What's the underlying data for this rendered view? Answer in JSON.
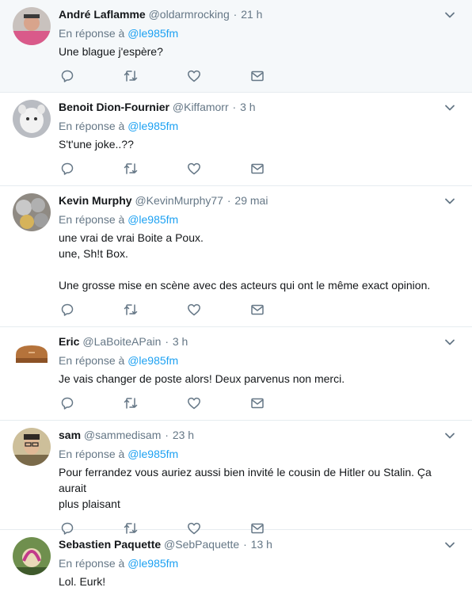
{
  "reply_prefix": "En réponse à",
  "tweets": [
    {
      "name": "André Laflamme",
      "handle": "@oldarmrocking",
      "time": "21 h",
      "reply_to": "@le985fm",
      "lines": [
        "Une blague j'espère?"
      ],
      "highlight": true
    },
    {
      "name": "Benoit Dion-Fournier",
      "handle": "@Kiffamorr",
      "time": "3 h",
      "reply_to": "@le985fm",
      "lines": [
        "S't'une joke..??"
      ]
    },
    {
      "name": "Kevin Murphy",
      "handle": "@KevinMurphy77",
      "time": "29 mai",
      "reply_to": "@le985fm",
      "lines": [
        "une vrai de vrai Boite a Poux.",
        "une, Sh!t Box.",
        "Une grosse mise en scène avec des acteurs qui ont le même exact opinion."
      ]
    },
    {
      "name": "Eric",
      "handle": "@LaBoiteAPain",
      "time": "3 h",
      "reply_to": "@le985fm",
      "lines": [
        "Je vais changer de poste alors! Deux parvenus non merci."
      ]
    },
    {
      "name": "sam",
      "handle": "@sammedisam",
      "time": "23 h",
      "reply_to": "@le985fm",
      "lines": [
        "Pour ferrandez vous auriez aussi bien invité le cousin de Hitler ou Stalin. Ça aurait",
        "plus plaisant"
      ]
    },
    {
      "name": "Sebastien Paquette",
      "handle": "@SebPaquette",
      "time": "13 h",
      "reply_to": "@le985fm",
      "lines": [
        "Lol. Eurk!"
      ]
    }
  ],
  "icons": {
    "reply": "reply-icon",
    "retweet": "retweet-icon",
    "like": "heart-icon",
    "dm": "envelope-icon",
    "more": "chevron-down-icon"
  },
  "colors": {
    "icon": "#657786",
    "link": "#1da1f2",
    "highlight_bg": "#f5f8fa"
  }
}
